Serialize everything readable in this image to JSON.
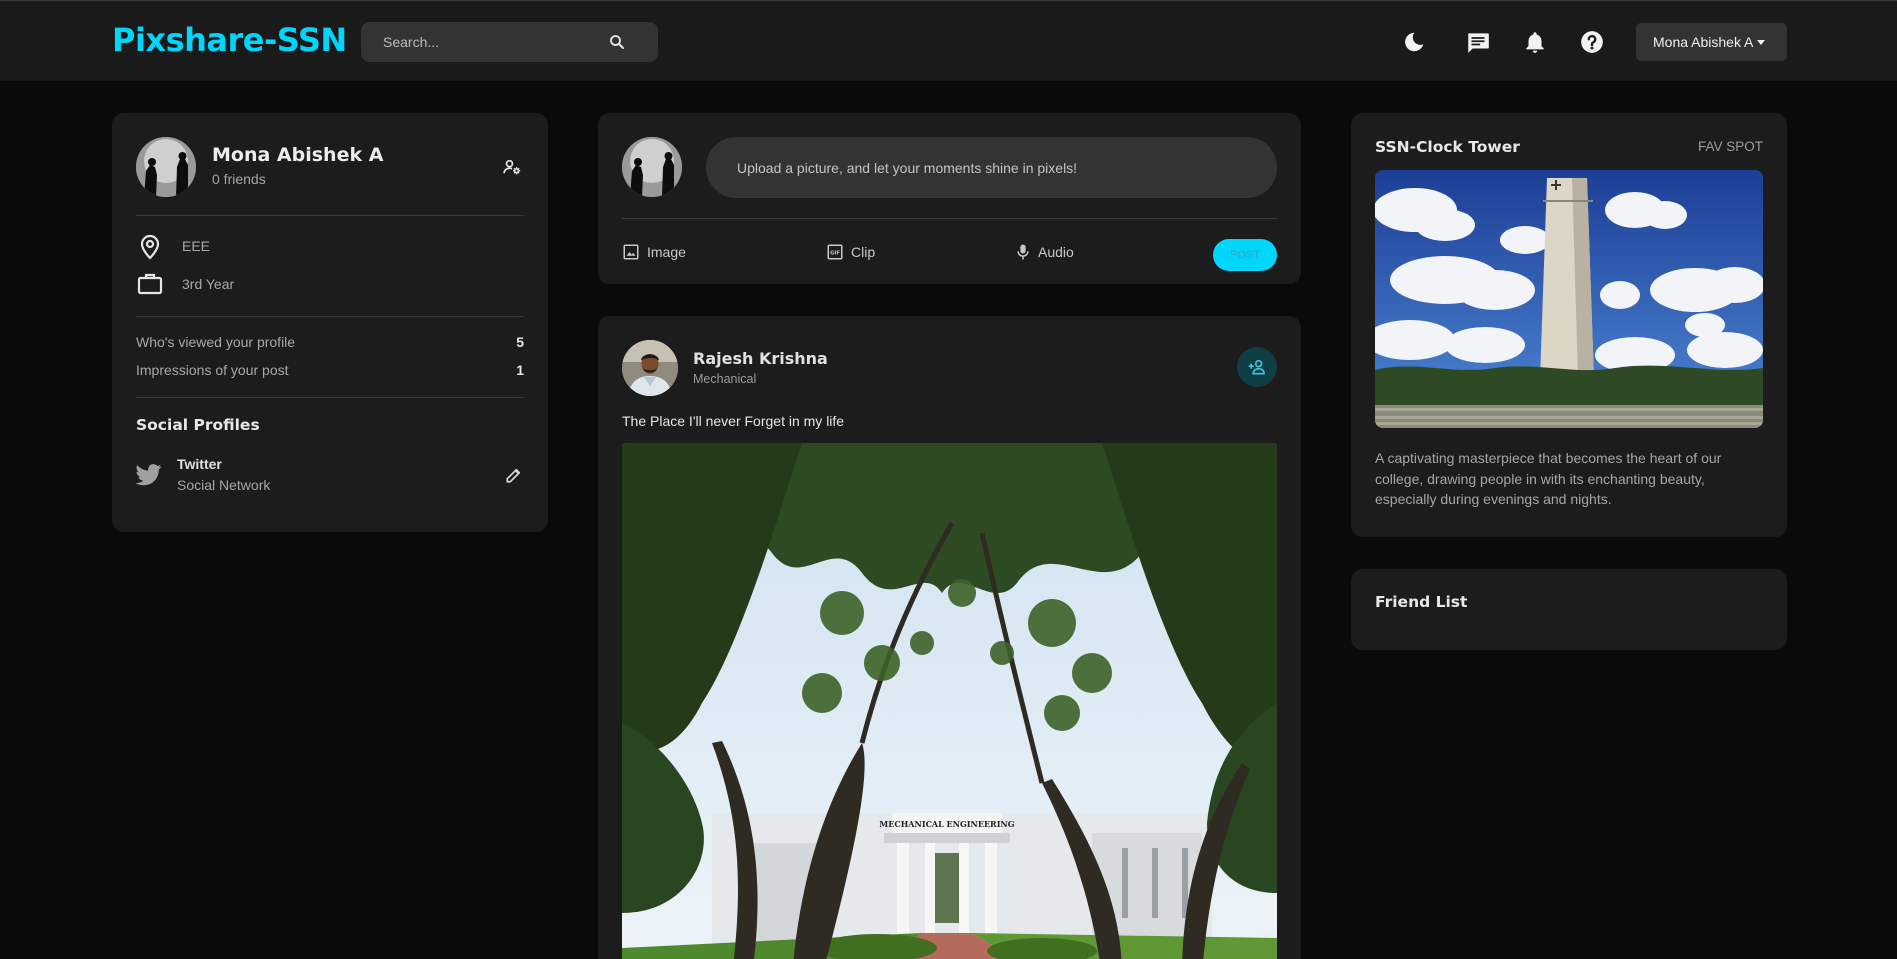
{
  "navbar": {
    "brand": "Pixshare-SSN",
    "search_placeholder": "Search...",
    "icons": [
      "search-icon",
      "moon-icon",
      "message-icon",
      "bell-icon",
      "help-icon"
    ],
    "user_menu_label": "Mona Abishek A"
  },
  "profile": {
    "name": "Mona Abishek A",
    "friends": "0 friends",
    "department": "EEE",
    "year": "3rd Year",
    "stats": [
      {
        "label": "Who's viewed your profile",
        "value": "5"
      },
      {
        "label": "Impressions of your post",
        "value": "1"
      }
    ],
    "social_heading": "Social Profiles",
    "social": [
      {
        "name": "Twitter",
        "subtitle": "Social Network"
      }
    ]
  },
  "composer": {
    "placeholder": "Upload a picture, and let your moments shine in pixels!",
    "image_label": "Image",
    "clip_label": "Clip",
    "audio_label": "Audio",
    "post_label": "POST"
  },
  "post": {
    "author": "Rajesh Krishna",
    "department": "Mechanical",
    "caption": "The Place I'll never Forget in my life",
    "image_sign": "MECHANICAL ENGINEERING"
  },
  "fav_spot": {
    "title": "SSN-Clock Tower",
    "tag": "FAV SPOT",
    "description": "A captivating masterpiece that becomes the heart of our college, drawing people in with its enchanting beauty, especially during evenings and nights."
  },
  "friend_list": {
    "title": "Friend List"
  },
  "colors": {
    "accent": "#00d5fa",
    "card": "#1c1c1c",
    "background": "#0a0a0a"
  }
}
